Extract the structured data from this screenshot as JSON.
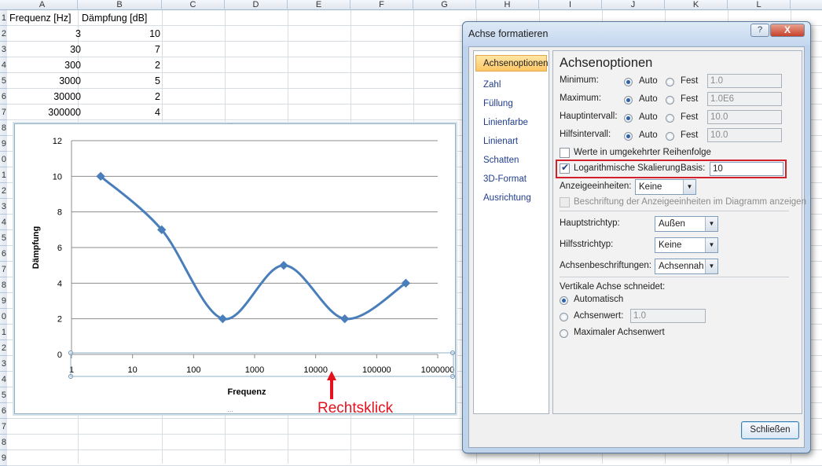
{
  "sheet": {
    "columns": [
      "A",
      "B",
      "C",
      "D",
      "E",
      "F",
      "G",
      "H",
      "I",
      "J",
      "K",
      "L"
    ],
    "rows": [
      "1",
      "2",
      "3",
      "4",
      "5",
      "6",
      "7",
      "8",
      "9",
      "0",
      "1",
      "2",
      "3",
      "4",
      "5",
      "6",
      "7",
      "8",
      "9",
      "0",
      "1",
      "2",
      "3",
      "4",
      "5",
      "6",
      "7",
      "8",
      "9"
    ],
    "header_a": "Frequenz [Hz]",
    "header_b": "Dämpfung [dB]",
    "data": [
      {
        "a": "3",
        "b": "10"
      },
      {
        "a": "30",
        "b": "7"
      },
      {
        "a": "300",
        "b": "2"
      },
      {
        "a": "3000",
        "b": "5"
      },
      {
        "a": "30000",
        "b": "2"
      },
      {
        "a": "300000",
        "b": "4"
      }
    ]
  },
  "chart_data": {
    "type": "line",
    "xlabel": "Frequenz",
    "ylabel": "Dämpfung",
    "x_scale": "log",
    "x_ticks": [
      "1",
      "10",
      "100",
      "1000",
      "10000",
      "100000",
      "1000000"
    ],
    "y_ticks": [
      "0",
      "2",
      "4",
      "6",
      "8",
      "10",
      "12"
    ],
    "ylim": [
      0,
      12
    ],
    "xlim": [
      1,
      1000000
    ],
    "grid": "horizontal",
    "series": [
      {
        "x": [
          3,
          30,
          300,
          3000,
          30000,
          300000
        ],
        "y": [
          10,
          7,
          2,
          5,
          2,
          4
        ],
        "color": "#4a7ebb"
      }
    ]
  },
  "annotation": {
    "label": "Rechtsklick",
    "color": "#e4121f"
  },
  "dialog": {
    "title": "Achse formatieren",
    "help_label": "?",
    "close_label": "X",
    "nav": [
      "Achsenoptionen",
      "Zahl",
      "Füllung",
      "Linienfarbe",
      "Linienart",
      "Schatten",
      "3D-Format",
      "Ausrichtung"
    ],
    "panel_title": "Achsenoptionen",
    "minimum": {
      "label": "Minimum:",
      "auto": "Auto",
      "fixed": "Fest",
      "value": "1.0"
    },
    "maximum": {
      "label": "Maximum:",
      "auto": "Auto",
      "fixed": "Fest",
      "value": "1.0E6"
    },
    "major_unit": {
      "label": "Hauptintervall:",
      "auto": "Auto",
      "fixed": "Fest",
      "value": "10.0"
    },
    "minor_unit": {
      "label": "Hilfsintervall:",
      "auto": "Auto",
      "fixed": "Fest",
      "value": "10.0"
    },
    "reverse_order": "Werte in umgekehrter Reihenfolge",
    "log_scale": "Logarithmische Skalierung",
    "base_label": "Basis:",
    "base_value": "10",
    "display_units_label": "Anzeigeeinheiten:",
    "display_units_value": "Keine",
    "show_units_label": "Beschriftung der Anzeigeeinheiten im Diagramm anzeigen",
    "major_tick_label": "Hauptstrichtyp:",
    "major_tick_value": "Außen",
    "minor_tick_label": "Hilfsstrichtyp:",
    "minor_tick_value": "Keine",
    "axis_labels_label": "Achsenbeschriftungen:",
    "axis_labels_value": "Achsennah",
    "vertical_cross_label": "Vertikale Achse schneidet:",
    "cross_auto": "Automatisch",
    "cross_value_label": "Achsenwert:",
    "cross_value": "1.0",
    "cross_max": "Maximaler Achsenwert",
    "close_button": "Schließen"
  }
}
